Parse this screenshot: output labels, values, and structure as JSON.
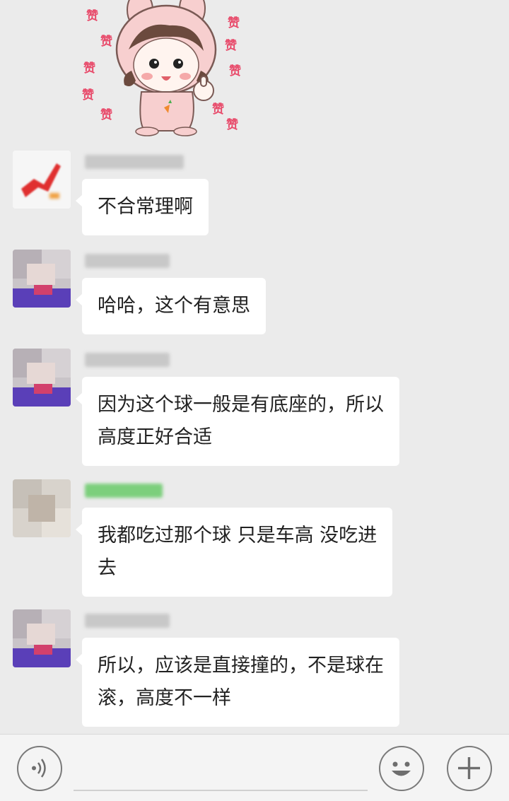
{
  "sticker": {
    "icon": "cartoon-girl-thumbs-up-sticker",
    "zan_char": "赞"
  },
  "messages": [
    {
      "avatar": "avatar-red-logo",
      "text": "不合常理啊",
      "name_color": "#c8c8c8"
    },
    {
      "avatar": "avatar-pixelated-a",
      "text": "哈哈，这个有意思",
      "name_color": "#c8c8c8"
    },
    {
      "avatar": "avatar-pixelated-a",
      "line1": "因为这个球一般是有底座的，所以",
      "line2": "高度正好合适",
      "name_color": "#c8c8c8"
    },
    {
      "avatar": "avatar-pixelated-b",
      "line1": "我都吃过那个球  只是车高 没吃进",
      "line2": "去",
      "name_color": "#7ccf7c"
    },
    {
      "avatar": "avatar-pixelated-a",
      "line1": "所以，应该是直接撞的，不是球在",
      "line2": "滚，高度不一样",
      "name_color": "#c8c8c8"
    }
  ],
  "inputbar": {
    "voice_icon": "voice-icon",
    "emoji_icon": "emoji-icon",
    "plus_icon": "plus-icon"
  }
}
